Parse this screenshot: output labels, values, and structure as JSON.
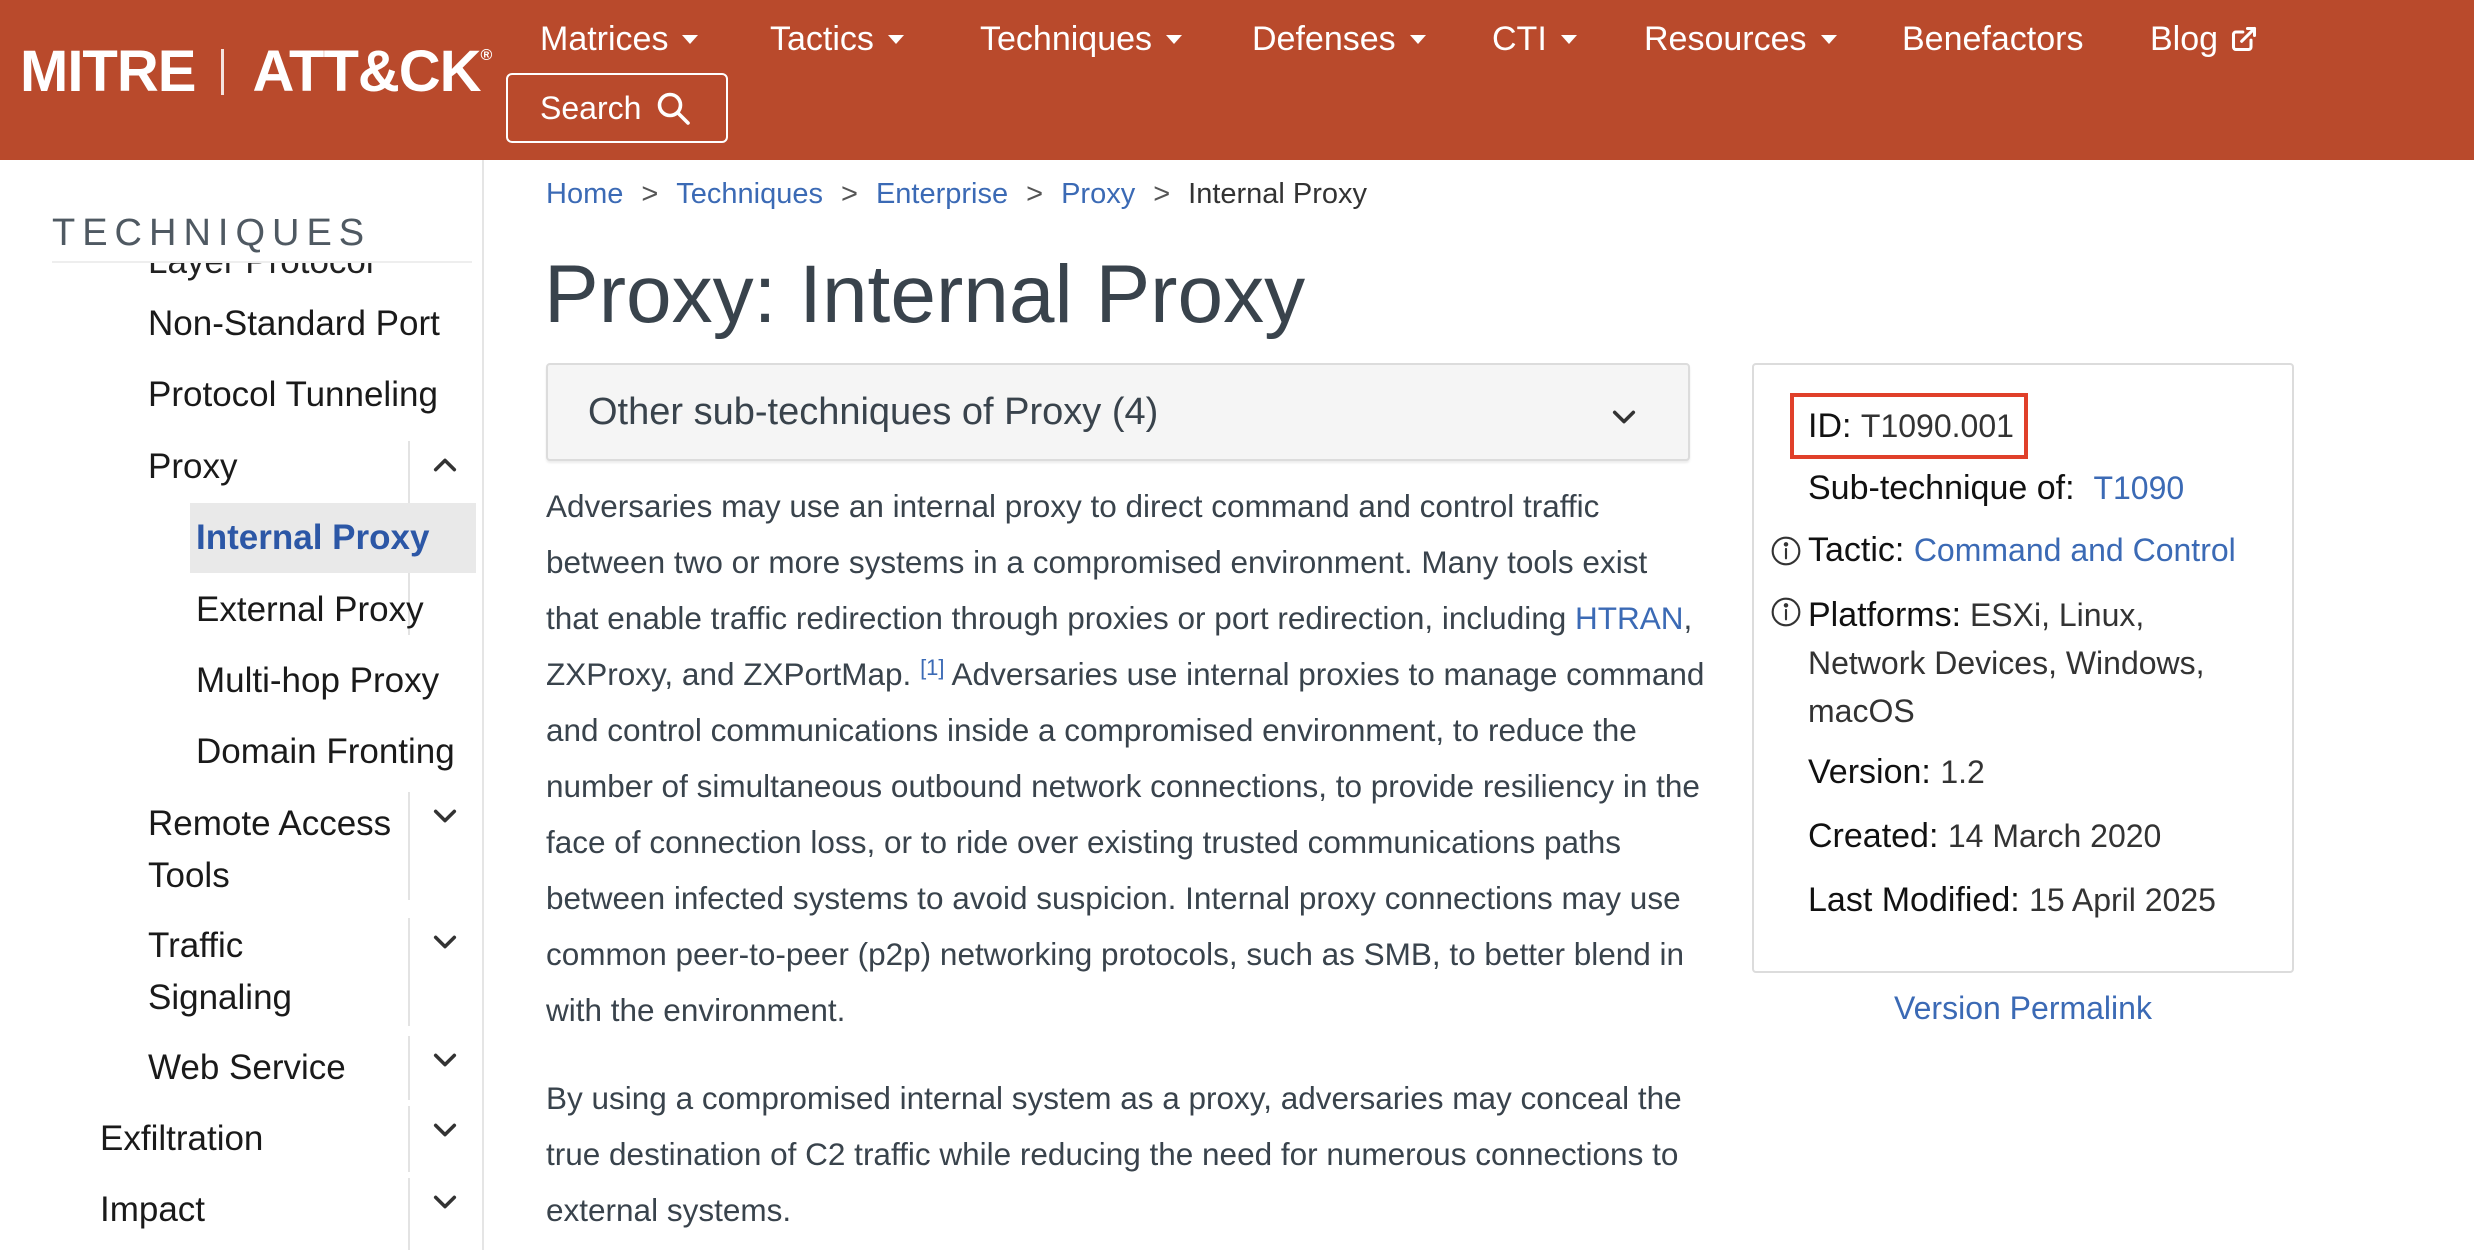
{
  "brand": {
    "mitre": "MITRE",
    "attack": "ATT&CK",
    "reg": "®"
  },
  "nav": {
    "items": [
      "Matrices",
      "Tactics",
      "Techniques",
      "Defenses",
      "CTI",
      "Resources",
      "Benefactors",
      "Blog"
    ],
    "search_label": "Search"
  },
  "sidebar": {
    "heading": "TECHNIQUES",
    "clipped_item": "Layer Protocol",
    "items": [
      "Non-Standard Port",
      "Protocol Tunneling",
      "Proxy",
      "Internal Proxy",
      "External Proxy",
      "Multi-hop Proxy",
      "Domain Fronting",
      "Remote Access",
      "Tools",
      "Traffic",
      "Signaling",
      "Web Service",
      "Exfiltration",
      "Impact"
    ]
  },
  "breadcrumb": [
    "Home",
    "Techniques",
    "Enterprise",
    "Proxy",
    "Internal Proxy"
  ],
  "page_title": "Proxy: Internal Proxy",
  "subtechniques_label": "Other sub-techniques of Proxy (4)",
  "description": {
    "p1_start": "Adversaries may use an internal proxy to direct command and control traffic between two or more systems in a compromised environment. Many tools exist that enable traffic redirection through proxies or port redirection, including ",
    "p1_link": "HTRAN",
    "p1_mid": ", ZXProxy, and ZXPortMap. ",
    "p1_ref": "[1]",
    "p1_end": " Adversaries use internal proxies to manage command and control communications inside a compromised environment, to reduce the number of simultaneous outbound network connections, to provide resiliency in the face of connection loss, or to ride over existing trusted communications paths between infected systems to avoid suspicion. Internal proxy connections may use common peer-to-peer (p2p) networking protocols, such as SMB, to better blend in with the environment.",
    "p2": "By using a compromised internal system as a proxy, adversaries may conceal the true destination of C2 traffic while reducing the need for numerous connections to external systems."
  },
  "info": {
    "id_label": "ID:",
    "id_value": "T1090.001",
    "subtech_label": "Sub-technique of:",
    "subtech_value": "T1090",
    "tactic_label": "Tactic:",
    "tactic_value": "Command and Control",
    "platforms_label": "Platforms:",
    "platforms_value": "ESXi, Linux, Network Devices, Windows, macOS",
    "version_label": "Version:",
    "version_value": "1.2",
    "created_label": "Created:",
    "created_value": "14 March 2020",
    "modified_label": "Last Modified:",
    "modified_value": "15 April 2025",
    "highlight_color": "#e0402a"
  },
  "permalink": "Version Permalink",
  "colors": {
    "navbar": "#b94a2c",
    "link": "#3b6ab5",
    "active": "#2c57a6"
  }
}
